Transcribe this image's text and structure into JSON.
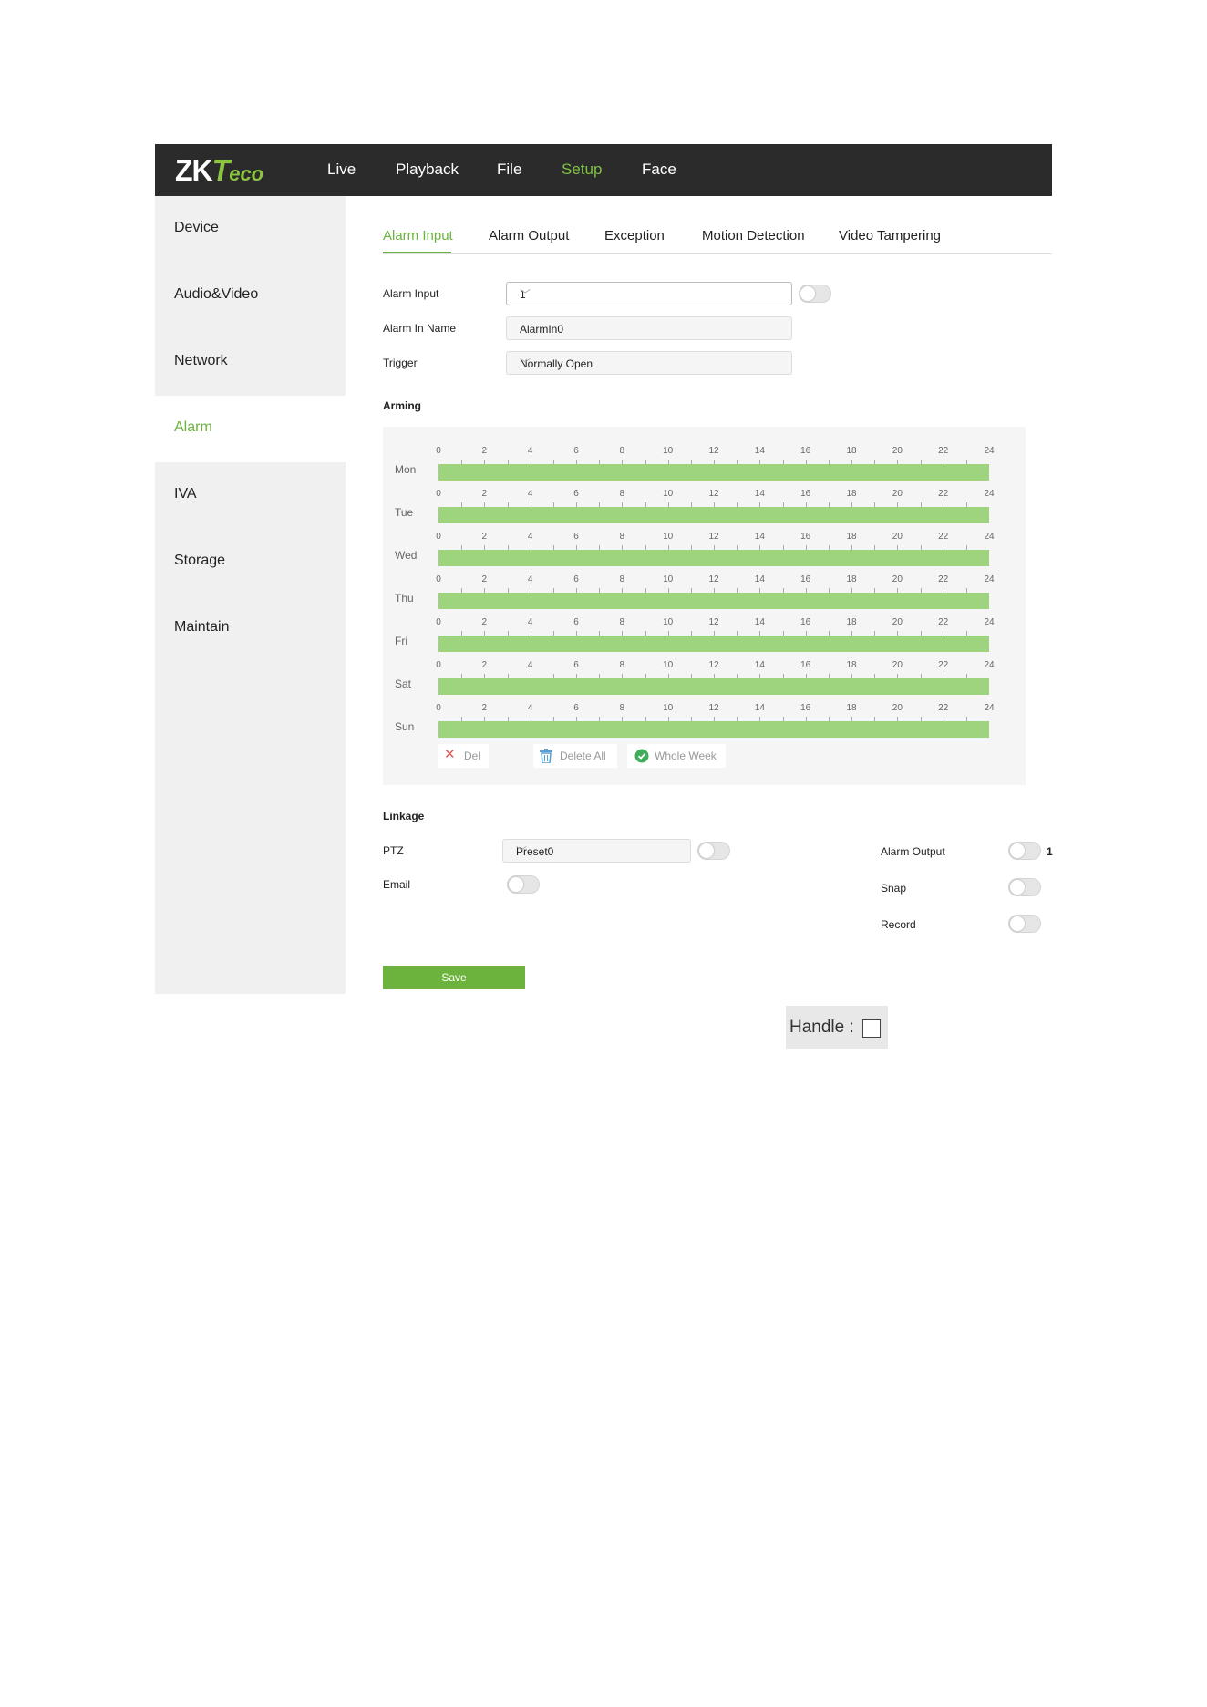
{
  "brand": {
    "logo_text": "ZKTeco",
    "accent_color": "#6cb33e",
    "schedule_color": "#9fd47e"
  },
  "topnav": [
    {
      "label": "Live",
      "active": false
    },
    {
      "label": "Playback",
      "active": false
    },
    {
      "label": "File",
      "active": false
    },
    {
      "label": "Setup",
      "active": true
    },
    {
      "label": "Face",
      "active": false
    }
  ],
  "sidebar": [
    {
      "label": "Device",
      "active": false
    },
    {
      "label": "Audio&Video",
      "active": false
    },
    {
      "label": "Network",
      "active": false
    },
    {
      "label": "Alarm",
      "active": true
    },
    {
      "label": "IVA",
      "active": false
    },
    {
      "label": "Storage",
      "active": false
    },
    {
      "label": "Maintain",
      "active": false
    }
  ],
  "tabs": [
    {
      "label": "Alarm Input",
      "active": true
    },
    {
      "label": "Alarm Output",
      "active": false
    },
    {
      "label": "Exception",
      "active": false
    },
    {
      "label": "Motion Detection",
      "active": false
    },
    {
      "label": "Video Tampering",
      "active": false
    }
  ],
  "form": {
    "alarm_input": {
      "label": "Alarm Input",
      "value": "1",
      "enabled": false
    },
    "alarm_in_name": {
      "label": "Alarm In Name",
      "value": "AlarmIn0"
    },
    "trigger": {
      "label": "Trigger",
      "value": "Normally Open"
    }
  },
  "arming": {
    "title": "Arming",
    "hours": [
      "0",
      "2",
      "4",
      "6",
      "8",
      "10",
      "12",
      "14",
      "16",
      "18",
      "20",
      "22",
      "24"
    ],
    "days": [
      {
        "name": "Mon",
        "start": 0,
        "end": 24
      },
      {
        "name": "Tue",
        "start": 0,
        "end": 24
      },
      {
        "name": "Wed",
        "start": 0,
        "end": 24
      },
      {
        "name": "Thu",
        "start": 0,
        "end": 24
      },
      {
        "name": "Fri",
        "start": 0,
        "end": 24
      },
      {
        "name": "Sat",
        "start": 0,
        "end": 24
      },
      {
        "name": "Sun",
        "start": 0,
        "end": 24
      }
    ],
    "buttons": {
      "del": "Del",
      "delete_all": "Delete All",
      "whole_week": "Whole Week"
    }
  },
  "linkage": {
    "title": "Linkage",
    "ptz": {
      "label": "PTZ",
      "value": "Preset0",
      "enabled": false
    },
    "email": {
      "label": "Email",
      "enabled": false
    },
    "alarm_output": {
      "label": "Alarm Output",
      "enabled": false,
      "number": "1"
    },
    "snap": {
      "label": "Snap",
      "enabled": false
    },
    "record": {
      "label": "Record",
      "enabled": false
    }
  },
  "save_label": "Save",
  "handle": {
    "label": "Handle :",
    "checked": false
  }
}
